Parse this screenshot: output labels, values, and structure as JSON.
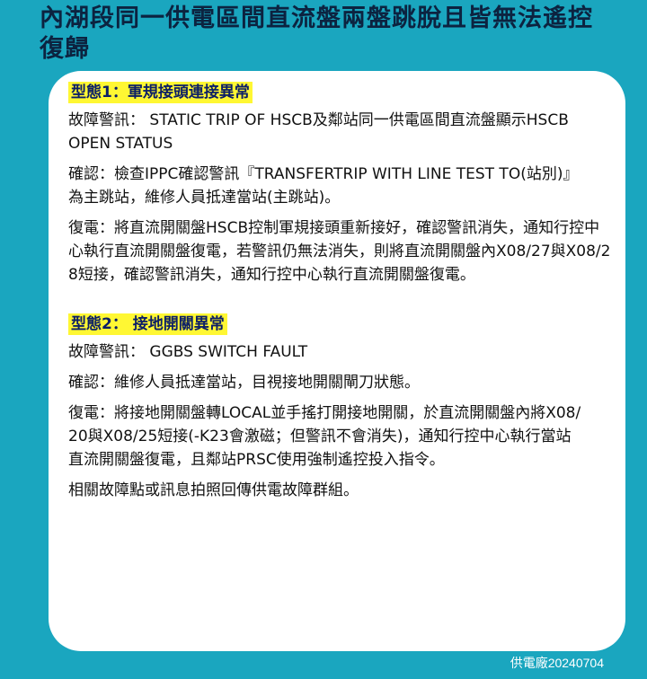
{
  "title": "內湖段同一供電區間直流盤兩盤跳脫且皆無法遙控復歸",
  "sections": [
    {
      "heading": "型態1：軍規接頭連接異常",
      "alarm": "故障警訊： STATIC TRIP OF HSCB及鄰站同一供電區間直流盤顯示HSCB OPEN STATUS",
      "confirm": "確認：檢查IPPC確認警訊『TRANSFERTRIP WITH LINE TEST TO(站別)』為主跳站，維修人員抵達當站(主跳站)。",
      "restore": "復電：將直流開關盤HSCB控制軍規接頭重新接好，確認警訊消失，通知行控中心執行直流開關盤復電，若警訊仍無法消失，則將直流開關盤內X08/27與X08/28短接，確認警訊消失，通知行控中心執行直流開關盤復電。"
    },
    {
      "heading": "型態2： 接地開關異常",
      "alarm": "故障警訊： GGBS SWITCH FAULT",
      "confirm": "確認：維修人員抵達當站，目視接地開關閘刀狀態。",
      "restore": "復電：將接地開關盤轉LOCAL並手搖打開接地開關，於直流開關盤內將X08/20與X08/25短接(-K23會激磁；但警訊不會消失)，通知行控中心執行當站直流開關盤復電，且鄰站PRSC使用強制遙控投入指令。"
    }
  ],
  "footer_note": "相關故障點或訊息拍照回傳供電故障群組。",
  "signature": "供電廠20240704"
}
